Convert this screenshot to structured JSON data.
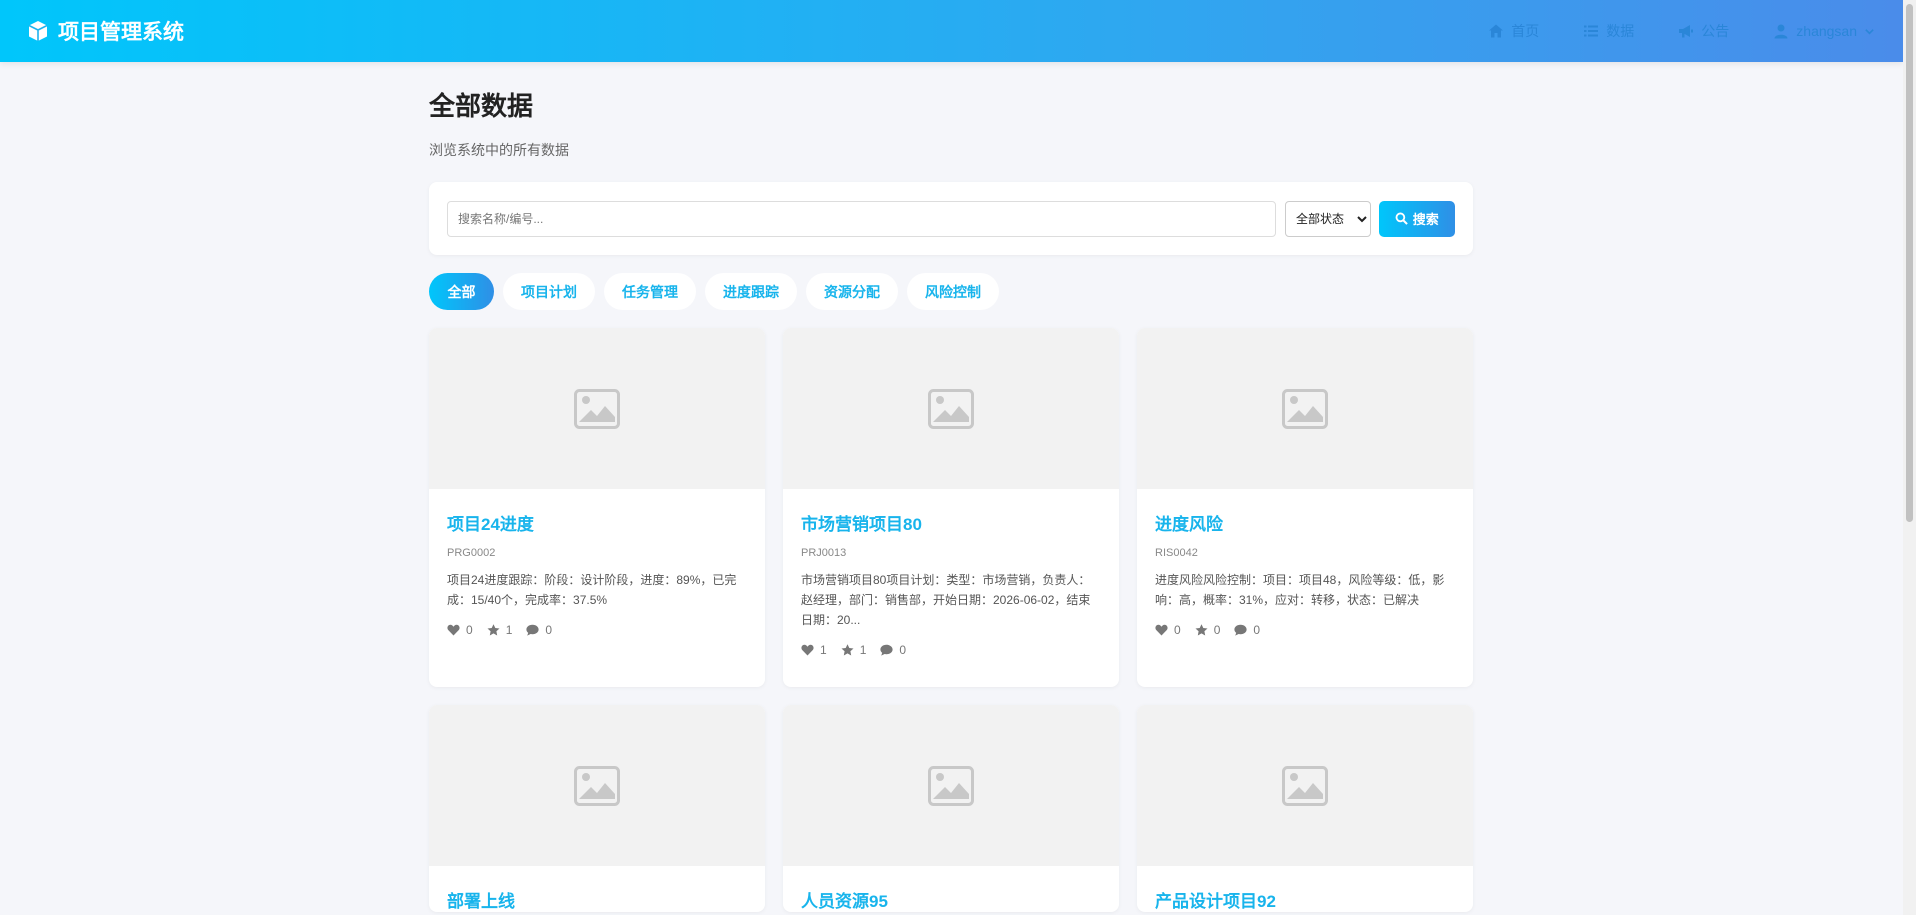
{
  "header": {
    "brand": "项目管理系统",
    "nav": [
      {
        "label": "首页",
        "icon": "home-icon"
      },
      {
        "label": "数据",
        "icon": "list-icon"
      },
      {
        "label": "公告",
        "icon": "megaphone-icon"
      },
      {
        "label": "zhangsan",
        "icon": "user-icon"
      }
    ]
  },
  "page": {
    "title": "全部数据",
    "subtitle": "浏览系统中的所有数据"
  },
  "search": {
    "placeholder": "搜索名称/编号...",
    "status_selected": "全部状态",
    "button_label": "搜索"
  },
  "tabs": [
    "全部",
    "项目计划",
    "任务管理",
    "进度跟踪",
    "资源分配",
    "风险控制"
  ],
  "cards": [
    {
      "title": "项目24进度",
      "code": "PRG0002",
      "desc": "项目24进度跟踪：阶段：设计阶段，进度：89%，已完成：15/40个，完成率：37.5%",
      "likes": "0",
      "favs": "1",
      "comments": "0"
    },
    {
      "title": "市场营销项目80",
      "code": "PRJ0013",
      "desc": "市场营销项目80项目计划：类型：市场营销，负责人：赵经理，部门：销售部，开始日期：2026-06-02，结束日期：20...",
      "likes": "1",
      "favs": "1",
      "comments": "0"
    },
    {
      "title": "进度风险",
      "code": "RIS0042",
      "desc": "进度风险风险控制：项目：项目48，风险等级：低，影响：高，概率：31%，应对：转移，状态：已解决",
      "likes": "0",
      "favs": "0",
      "comments": "0"
    },
    {
      "title": "部署上线"
    },
    {
      "title": "人员资源95"
    },
    {
      "title": "产品设计项目92"
    }
  ],
  "colors": {
    "accent": "#18b4ec",
    "header_start": "#00c6fb",
    "header_end": "#4a8cea"
  }
}
